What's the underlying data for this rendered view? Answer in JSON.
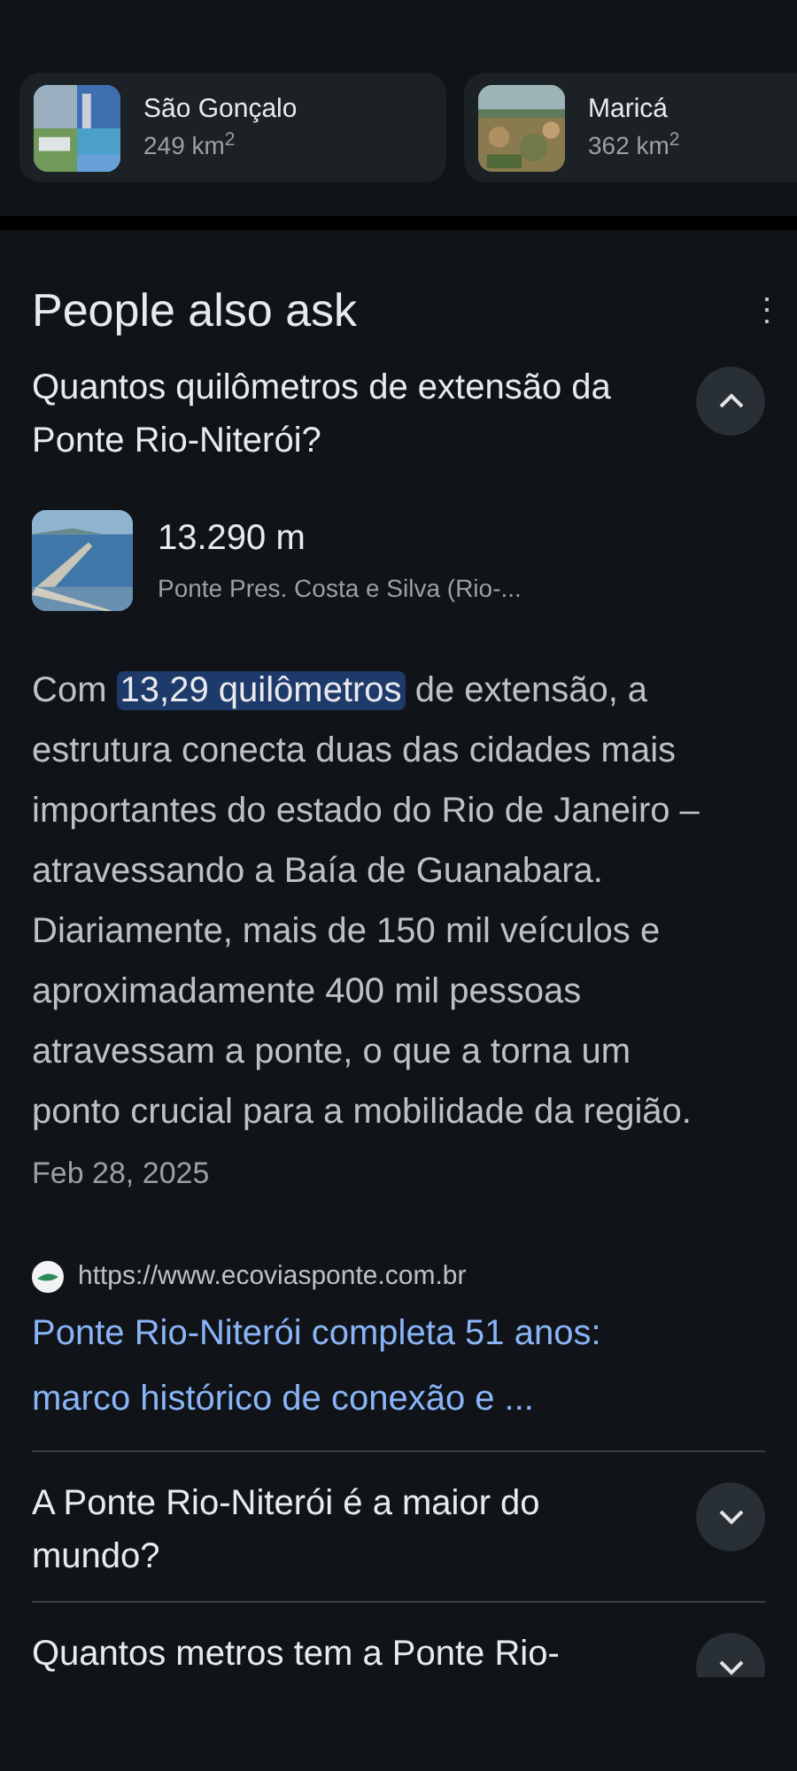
{
  "cards": [
    {
      "title": "São Gonçalo",
      "subtitle": "249 km$^{2}$",
      "kind": "picture"
    },
    {
      "title": "Maricá",
      "subtitle": "362 km$^{2}$",
      "kind": "picture"
    }
  ],
  "section": {
    "title": "People also ask",
    "menu_icon": "⋮"
  },
  "questions": [
    {
      "text": "Quantos quilômetros de extensão da Ponte Rio-Niterói?",
      "expanded": true,
      "answer": {
        "value": "13.290 m",
        "entity": "Ponte Pres. Costa e Silva (Rio-...",
        "text_before": "Com ",
        "highlight": "13,29 quilômetros",
        "text_after": " de extensão, a estrutura conecta duas das cidades mais importantes do estado do Rio de Janeiro – atravessando a Baía de Guanabara. Diariamente, mais de 150 mil veículos e aproximadamente 400 mil pessoas atravessam a ponte, o que a torna um ponto crucial para a mobilidade da região.",
        "date": "Feb 28, 2025",
        "source_url": "https://www.ecoviasponte.com.br",
        "link": "Ponte Rio-Niterói completa 51 anos: marco histórico de conexão e ..."
      }
    },
    {
      "text": "A Ponte Rio-Niterói é a maior do mundo?",
      "expanded": false
    },
    {
      "text": "Quantos metros tem a Ponte Rio-",
      "expanded": false
    }
  ]
}
